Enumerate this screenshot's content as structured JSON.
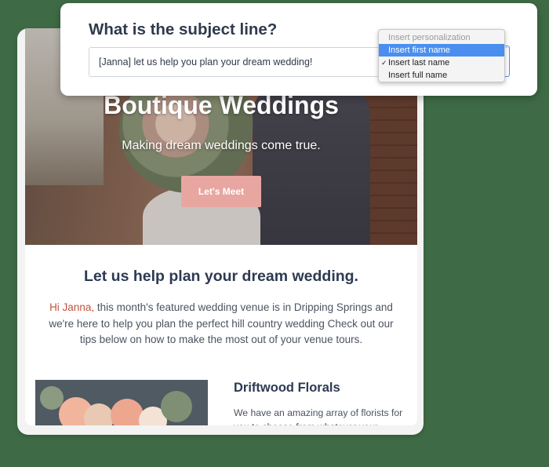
{
  "subject": {
    "label": "What is the subject line?",
    "value": "[Janna] let us help you plan your dream wedding!"
  },
  "personalization_menu": {
    "placeholder": "Insert personalization",
    "options": [
      {
        "label": "Insert first name",
        "highlighted": true,
        "checked": false
      },
      {
        "label": "Insert last name",
        "highlighted": false,
        "checked": true
      },
      {
        "label": "Insert full name",
        "highlighted": false,
        "checked": false
      }
    ],
    "check_glyph": "✓"
  },
  "email": {
    "hero": {
      "title": "Boutique Weddings",
      "tagline": "Making dream weddings come true.",
      "cta_label": "Let's Meet"
    },
    "heading": "Let us help plan your dream wedding.",
    "greeting": "Hi Janna,",
    "body": " this month's featured wedding venue is in Dripping Springs and we're here to help you plan the perfect hill country wedding Check out our tips below on how to make the most out of your venue tours.",
    "section": {
      "title": "Driftwood Florals",
      "text": "We have an amazing array of florists for you to choose from whatever your"
    }
  },
  "colors": {
    "background": "#3e6b45",
    "cta": "#e8a6a1",
    "heading": "#2d3a52",
    "greeting": "#c0543e",
    "highlight": "#4a8ff0",
    "focus_border": "#4d90fe"
  }
}
